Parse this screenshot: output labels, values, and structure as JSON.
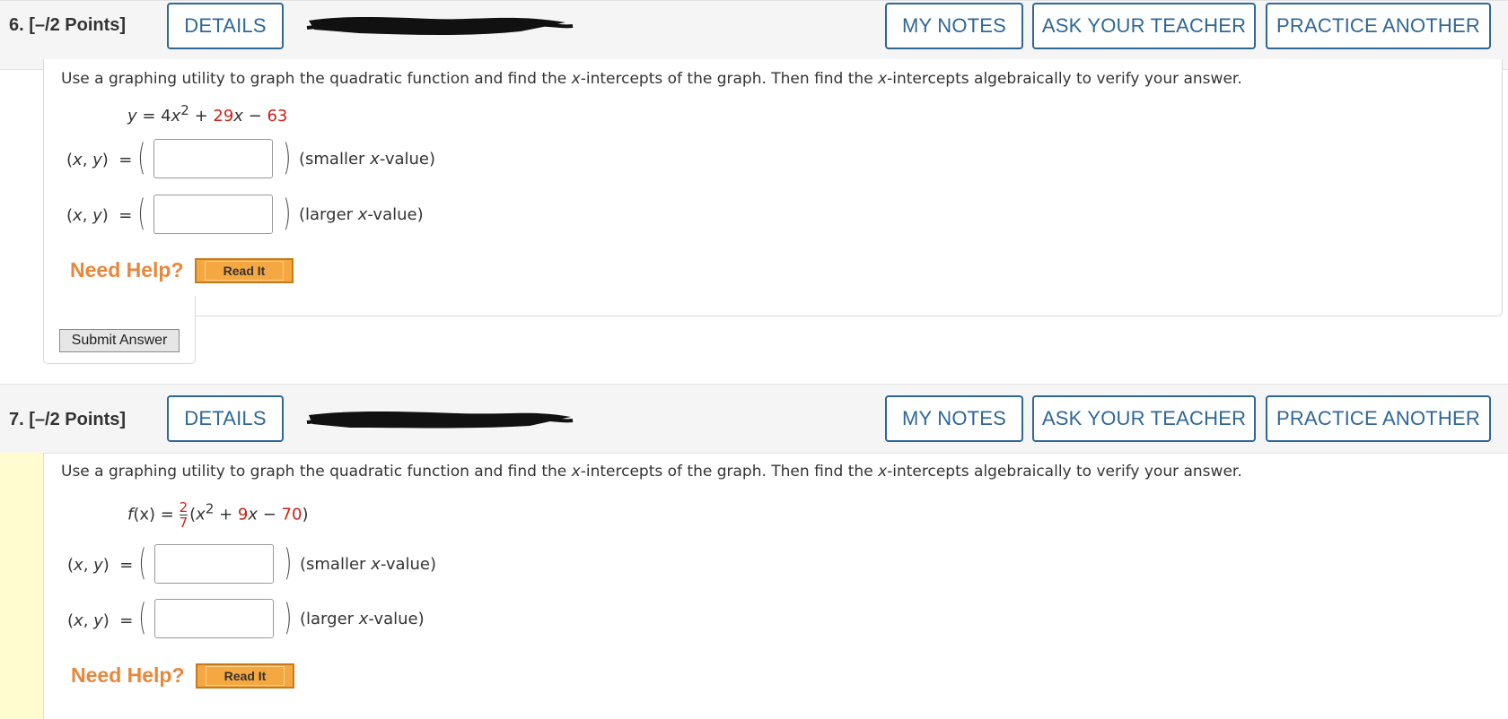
{
  "q6": {
    "number": "6.",
    "points": "[–/2 Points]",
    "details": "DETAILS",
    "my_notes": "MY NOTES",
    "ask_teacher": "ASK YOUR TEACHER",
    "practice": "PRACTICE ANOTHER",
    "prompt_pre1": "Use a graphing utility to graph the quadratic function and find the ",
    "prompt_x1": "x",
    "prompt_mid": "-intercepts of the graph. Then find the ",
    "prompt_x2": "x",
    "prompt_post": "-intercepts algebraically to verify your answer.",
    "equation": {
      "lhs": "y",
      "eq": " = 4",
      "x1": "x",
      "exp": "2",
      "plus": " + ",
      "coef": "29",
      "x2": "x",
      "minus": " − ",
      "const": "63"
    },
    "answers": [
      {
        "label_x": "x",
        "label_y": "y",
        "value": "",
        "hint_pre": "(smaller ",
        "hint_x": "x",
        "hint_post": "-value)"
      },
      {
        "label_x": "x",
        "label_y": "y",
        "value": "",
        "hint_pre": "(larger ",
        "hint_x": "x",
        "hint_post": "-value)"
      }
    ],
    "need_help": "Need Help?",
    "read_it": "Read It",
    "submit": "Submit Answer"
  },
  "q7": {
    "number": "7.",
    "points": "[–/2 Points]",
    "details": "DETAILS",
    "my_notes": "MY NOTES",
    "ask_teacher": "ASK YOUR TEACHER",
    "practice": "PRACTICE ANOTHER",
    "prompt_pre1": "Use a graphing utility to graph the quadratic function and find the ",
    "prompt_x1": "x",
    "prompt_mid": "-intercepts of the graph. Then find the ",
    "prompt_x2": "x",
    "prompt_post": "-intercepts algebraically to verify your answer.",
    "equation": {
      "fn": "f",
      "arg": "(x) = ",
      "num": "2",
      "den": "7",
      "open": "(",
      "x1": "x",
      "exp": "2",
      "plus": " + ",
      "coef": "9",
      "x2": "x",
      "minus": " − ",
      "const": "70",
      "close": ")"
    },
    "answers": [
      {
        "label_x": "x",
        "label_y": "y",
        "value": "",
        "hint_pre": "(smaller ",
        "hint_x": "x",
        "hint_post": "-value)"
      },
      {
        "label_x": "x",
        "label_y": "y",
        "value": "",
        "hint_pre": "(larger ",
        "hint_x": "x",
        "hint_post": "-value)"
      }
    ],
    "need_help": "Need Help?",
    "read_it": "Read It"
  },
  "colors": {
    "accent_blue": "#2f6796",
    "param_red": "#d0201a",
    "help_orange": "#e8873a",
    "readit_orange": "#f5a742"
  }
}
